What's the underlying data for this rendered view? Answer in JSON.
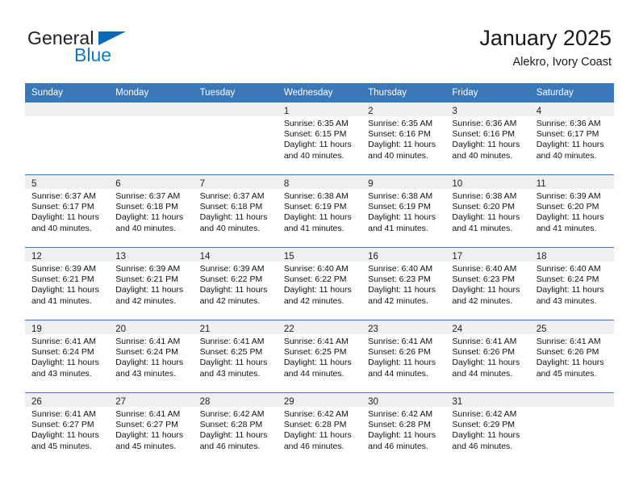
{
  "brand": {
    "name_top": "General",
    "name_bottom": "Blue",
    "triangle_color": "#0a6ab5",
    "text_color": "#231f20",
    "blue_color": "#1177c4"
  },
  "header": {
    "title": "January 2025",
    "subtitle": "Alekro, Ivory Coast"
  },
  "theme": {
    "header_blue": "#3a78b8",
    "daynum_band": "#efeff0",
    "grid_line": "#3a78b8"
  },
  "weekdays": [
    "Sunday",
    "Monday",
    "Tuesday",
    "Wednesday",
    "Thursday",
    "Friday",
    "Saturday"
  ],
  "weeks": [
    [
      {
        "day": "",
        "lines": []
      },
      {
        "day": "",
        "lines": []
      },
      {
        "day": "",
        "lines": []
      },
      {
        "day": "1",
        "lines": [
          "Sunrise: 6:35 AM",
          "Sunset: 6:15 PM",
          "Daylight: 11 hours",
          "and 40 minutes."
        ]
      },
      {
        "day": "2",
        "lines": [
          "Sunrise: 6:35 AM",
          "Sunset: 6:16 PM",
          "Daylight: 11 hours",
          "and 40 minutes."
        ]
      },
      {
        "day": "3",
        "lines": [
          "Sunrise: 6:36 AM",
          "Sunset: 6:16 PM",
          "Daylight: 11 hours",
          "and 40 minutes."
        ]
      },
      {
        "day": "4",
        "lines": [
          "Sunrise: 6:36 AM",
          "Sunset: 6:17 PM",
          "Daylight: 11 hours",
          "and 40 minutes."
        ]
      }
    ],
    [
      {
        "day": "5",
        "lines": [
          "Sunrise: 6:37 AM",
          "Sunset: 6:17 PM",
          "Daylight: 11 hours",
          "and 40 minutes."
        ]
      },
      {
        "day": "6",
        "lines": [
          "Sunrise: 6:37 AM",
          "Sunset: 6:18 PM",
          "Daylight: 11 hours",
          "and 40 minutes."
        ]
      },
      {
        "day": "7",
        "lines": [
          "Sunrise: 6:37 AM",
          "Sunset: 6:18 PM",
          "Daylight: 11 hours",
          "and 40 minutes."
        ]
      },
      {
        "day": "8",
        "lines": [
          "Sunrise: 6:38 AM",
          "Sunset: 6:19 PM",
          "Daylight: 11 hours",
          "and 41 minutes."
        ]
      },
      {
        "day": "9",
        "lines": [
          "Sunrise: 6:38 AM",
          "Sunset: 6:19 PM",
          "Daylight: 11 hours",
          "and 41 minutes."
        ]
      },
      {
        "day": "10",
        "lines": [
          "Sunrise: 6:38 AM",
          "Sunset: 6:20 PM",
          "Daylight: 11 hours",
          "and 41 minutes."
        ]
      },
      {
        "day": "11",
        "lines": [
          "Sunrise: 6:39 AM",
          "Sunset: 6:20 PM",
          "Daylight: 11 hours",
          "and 41 minutes."
        ]
      }
    ],
    [
      {
        "day": "12",
        "lines": [
          "Sunrise: 6:39 AM",
          "Sunset: 6:21 PM",
          "Daylight: 11 hours",
          "and 41 minutes."
        ]
      },
      {
        "day": "13",
        "lines": [
          "Sunrise: 6:39 AM",
          "Sunset: 6:21 PM",
          "Daylight: 11 hours",
          "and 42 minutes."
        ]
      },
      {
        "day": "14",
        "lines": [
          "Sunrise: 6:39 AM",
          "Sunset: 6:22 PM",
          "Daylight: 11 hours",
          "and 42 minutes."
        ]
      },
      {
        "day": "15",
        "lines": [
          "Sunrise: 6:40 AM",
          "Sunset: 6:22 PM",
          "Daylight: 11 hours",
          "and 42 minutes."
        ]
      },
      {
        "day": "16",
        "lines": [
          "Sunrise: 6:40 AM",
          "Sunset: 6:23 PM",
          "Daylight: 11 hours",
          "and 42 minutes."
        ]
      },
      {
        "day": "17",
        "lines": [
          "Sunrise: 6:40 AM",
          "Sunset: 6:23 PM",
          "Daylight: 11 hours",
          "and 42 minutes."
        ]
      },
      {
        "day": "18",
        "lines": [
          "Sunrise: 6:40 AM",
          "Sunset: 6:24 PM",
          "Daylight: 11 hours",
          "and 43 minutes."
        ]
      }
    ],
    [
      {
        "day": "19",
        "lines": [
          "Sunrise: 6:41 AM",
          "Sunset: 6:24 PM",
          "Daylight: 11 hours",
          "and 43 minutes."
        ]
      },
      {
        "day": "20",
        "lines": [
          "Sunrise: 6:41 AM",
          "Sunset: 6:24 PM",
          "Daylight: 11 hours",
          "and 43 minutes."
        ]
      },
      {
        "day": "21",
        "lines": [
          "Sunrise: 6:41 AM",
          "Sunset: 6:25 PM",
          "Daylight: 11 hours",
          "and 43 minutes."
        ]
      },
      {
        "day": "22",
        "lines": [
          "Sunrise: 6:41 AM",
          "Sunset: 6:25 PM",
          "Daylight: 11 hours",
          "and 44 minutes."
        ]
      },
      {
        "day": "23",
        "lines": [
          "Sunrise: 6:41 AM",
          "Sunset: 6:26 PM",
          "Daylight: 11 hours",
          "and 44 minutes."
        ]
      },
      {
        "day": "24",
        "lines": [
          "Sunrise: 6:41 AM",
          "Sunset: 6:26 PM",
          "Daylight: 11 hours",
          "and 44 minutes."
        ]
      },
      {
        "day": "25",
        "lines": [
          "Sunrise: 6:41 AM",
          "Sunset: 6:26 PM",
          "Daylight: 11 hours",
          "and 45 minutes."
        ]
      }
    ],
    [
      {
        "day": "26",
        "lines": [
          "Sunrise: 6:41 AM",
          "Sunset: 6:27 PM",
          "Daylight: 11 hours",
          "and 45 minutes."
        ]
      },
      {
        "day": "27",
        "lines": [
          "Sunrise: 6:41 AM",
          "Sunset: 6:27 PM",
          "Daylight: 11 hours",
          "and 45 minutes."
        ]
      },
      {
        "day": "28",
        "lines": [
          "Sunrise: 6:42 AM",
          "Sunset: 6:28 PM",
          "Daylight: 11 hours",
          "and 46 minutes."
        ]
      },
      {
        "day": "29",
        "lines": [
          "Sunrise: 6:42 AM",
          "Sunset: 6:28 PM",
          "Daylight: 11 hours",
          "and 46 minutes."
        ]
      },
      {
        "day": "30",
        "lines": [
          "Sunrise: 6:42 AM",
          "Sunset: 6:28 PM",
          "Daylight: 11 hours",
          "and 46 minutes."
        ]
      },
      {
        "day": "31",
        "lines": [
          "Sunrise: 6:42 AM",
          "Sunset: 6:29 PM",
          "Daylight: 11 hours",
          "and 46 minutes."
        ]
      },
      {
        "day": "",
        "lines": []
      }
    ]
  ]
}
